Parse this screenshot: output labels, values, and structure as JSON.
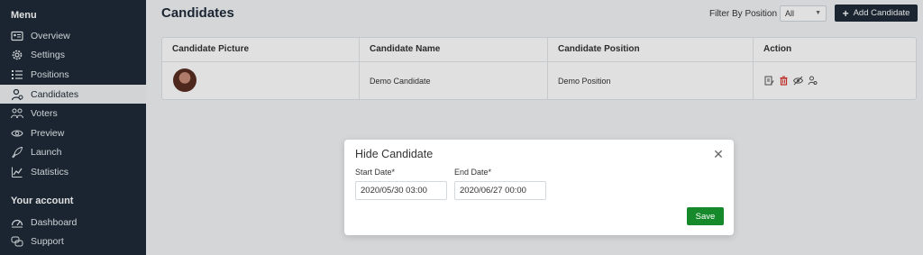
{
  "sidebar": {
    "menu_heading": "Menu",
    "account_heading": "Your account",
    "items": [
      {
        "label": "Overview",
        "icon": "overview-icon"
      },
      {
        "label": "Settings",
        "icon": "gear-icon"
      },
      {
        "label": "Positions",
        "icon": "list-icon"
      },
      {
        "label": "Candidates",
        "icon": "candidates-icon",
        "active": true
      },
      {
        "label": "Voters",
        "icon": "voters-icon"
      },
      {
        "label": "Preview",
        "icon": "eye-icon"
      },
      {
        "label": "Launch",
        "icon": "rocket-icon"
      },
      {
        "label": "Statistics",
        "icon": "chart-icon"
      }
    ],
    "account_items": [
      {
        "label": "Dashboard",
        "icon": "dashboard-icon"
      },
      {
        "label": "Support",
        "icon": "support-icon"
      }
    ]
  },
  "header": {
    "title": "Candidates",
    "filter_label": "Filter By Position",
    "filter_value": "All",
    "add_button": "Add Candidate"
  },
  "table": {
    "columns": [
      "Candidate Picture",
      "Candidate Name",
      "Candidate Position",
      "Action"
    ],
    "rows": [
      {
        "name": "Demo Candidate",
        "position": "Demo Position"
      }
    ]
  },
  "modal": {
    "title": "Hide Candidate",
    "start_label": "Start Date*",
    "start_value": "2020/05/30 03:00",
    "end_label": "End Date*",
    "end_value": "2020/06/27 00:00",
    "save_label": "Save"
  },
  "colors": {
    "sidebar_bg": "#1e2b38",
    "accent_dark": "#1e2b38",
    "save_green": "#16892a",
    "delete_red": "#d9342b"
  }
}
